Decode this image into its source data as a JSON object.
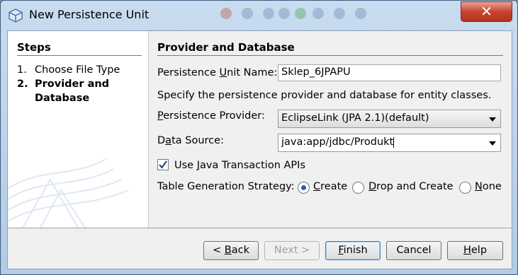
{
  "window": {
    "title": "New Persistence Unit",
    "close_symbol": "✕"
  },
  "steps": {
    "title": "Steps",
    "items": [
      {
        "num": "1.",
        "label": "Choose File Type"
      },
      {
        "num": "2.",
        "label_line1": "Provider and",
        "label_line2": "Database"
      }
    ]
  },
  "panel": {
    "title": "Provider and Database",
    "pu_name_label_a": "Persistence ",
    "pu_name_label_u": "U",
    "pu_name_label_b": "nit Name:",
    "pu_name_value": "Sklep_6JPAPU",
    "description": "Specify the persistence provider and database for entity classes.",
    "provider_label_u": "P",
    "provider_label_b": "ersistence Provider:",
    "provider_value": "EclipseLink (JPA 2.1)(default)",
    "datasource_label_a": "D",
    "datasource_label_u": "a",
    "datasource_label_b": "ta Source:",
    "datasource_value": "java:app/jdbc/Produkt",
    "jta_checked": true,
    "jta_label_a": "Use ",
    "jta_label_u": "J",
    "jta_label_b": "ava Transaction APIs",
    "strategy_label": "Table Generation Strategy:",
    "strategy_options": [
      {
        "u": "C",
        "rest": "reate",
        "selected": true
      },
      {
        "u": "D",
        "rest": "rop and Create",
        "selected": false
      },
      {
        "u": "N",
        "rest": "one",
        "selected": false
      }
    ]
  },
  "buttons": {
    "back_a": "< ",
    "back_u": "B",
    "back_b": "ack",
    "next": "Next >",
    "finish_u": "F",
    "finish_b": "inish",
    "cancel": "Cancel",
    "help_u": "H",
    "help_b": "elp"
  }
}
